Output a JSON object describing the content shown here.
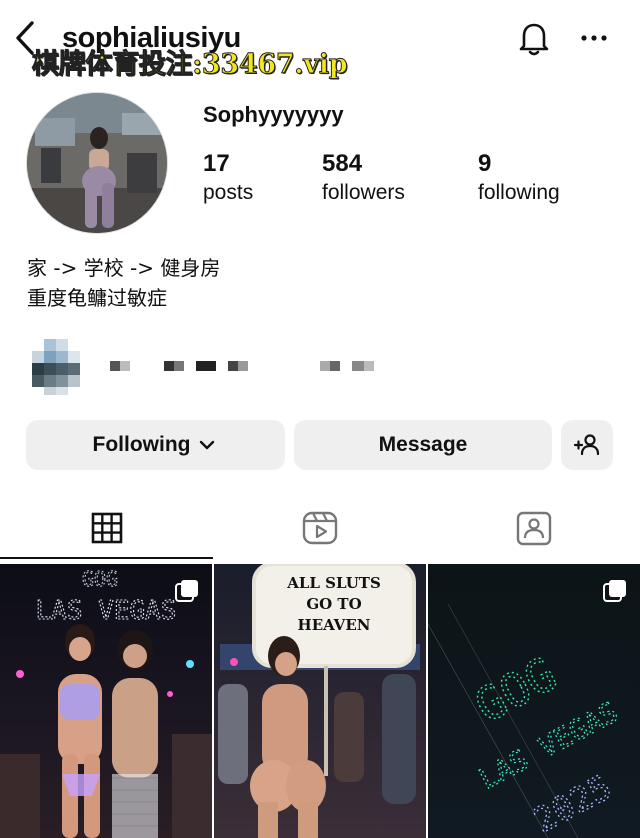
{
  "header": {
    "username": "sophialiusiyu",
    "watermark": "棋牌体育投注:33467.vip"
  },
  "profile": {
    "display_name": "Sophyyyyyyy",
    "posts_count": "17",
    "posts_label": "posts",
    "followers_count": "584",
    "followers_label": "followers",
    "following_count": "9",
    "following_label": "following",
    "bio_line1": "家 -> 学校 -> 健身房",
    "bio_line2": "重度龟鳙过敏症"
  },
  "actions": {
    "following_label": "Following",
    "message_label": "Message"
  },
  "tabs": [
    "grid-icon",
    "reels-icon",
    "tagged-icon"
  ],
  "posts": [
    {
      "overlay": "LAS VEGAS",
      "multi": true
    },
    {
      "sign_line1": "ALL SLUTS",
      "sign_line2": "GO TO",
      "sign_line3": "HEAVEN",
      "multi": false
    },
    {
      "overlay_top": "LAS VEGAS",
      "overlay_year": "2025",
      "multi": true
    }
  ]
}
